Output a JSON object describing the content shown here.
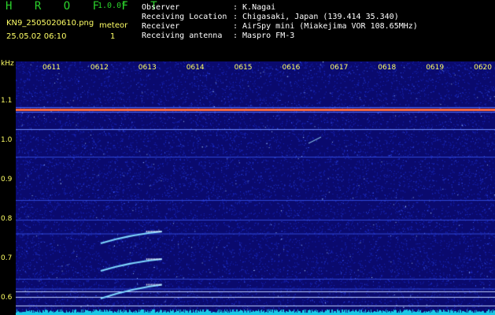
{
  "header": {
    "program": "H R O F F T",
    "version": "1.0.0f",
    "filename": "KN9_2505020610.png",
    "datetime": "25.05.02 06:10",
    "meteor_label": "meteor",
    "meteor_count": "1",
    "observer_label": "Observer",
    "observer_value": ": K.Nagai",
    "location_label": "Receiving Location",
    "location_value": ": Chigasaki, Japan (139.414 35.340)",
    "receiver_label": "Receiver",
    "receiver_value": ": AirSpy mini (Miakejima VOR 108.65MHz)",
    "antenna_label": "Receiving antenna",
    "antenna_value": ": Maspro FM-3"
  },
  "axes": {
    "y_unit": "kHz",
    "y_ticks": [
      "1.1",
      "1.0",
      "0.9",
      "0.8",
      "0.7",
      "0.6"
    ],
    "x_ticks": [
      "0611",
      "0612",
      "0613",
      "0614",
      "0615",
      "0616",
      "0617",
      "0618",
      "0619",
      "0620"
    ]
  },
  "colors": {
    "background": "#0a0a6e",
    "carrier": "#ff6a3c",
    "title_green": "#2bd12b",
    "label_yellow": "#ffff66"
  },
  "spectrogram": {
    "carrier_khz": 1.08,
    "carrier_echo_khz": 1.03,
    "meteor_traces": [
      {
        "start_time": "0612",
        "end_time": "0613",
        "f_start_khz": 0.74,
        "f_end_khz": 0.77
      },
      {
        "start_time": "0612",
        "end_time": "0613",
        "f_start_khz": 0.67,
        "f_end_khz": 0.7
      },
      {
        "start_time": "0612",
        "end_time": "0613",
        "f_start_khz": 0.6,
        "f_end_khz": 0.635
      }
    ]
  }
}
